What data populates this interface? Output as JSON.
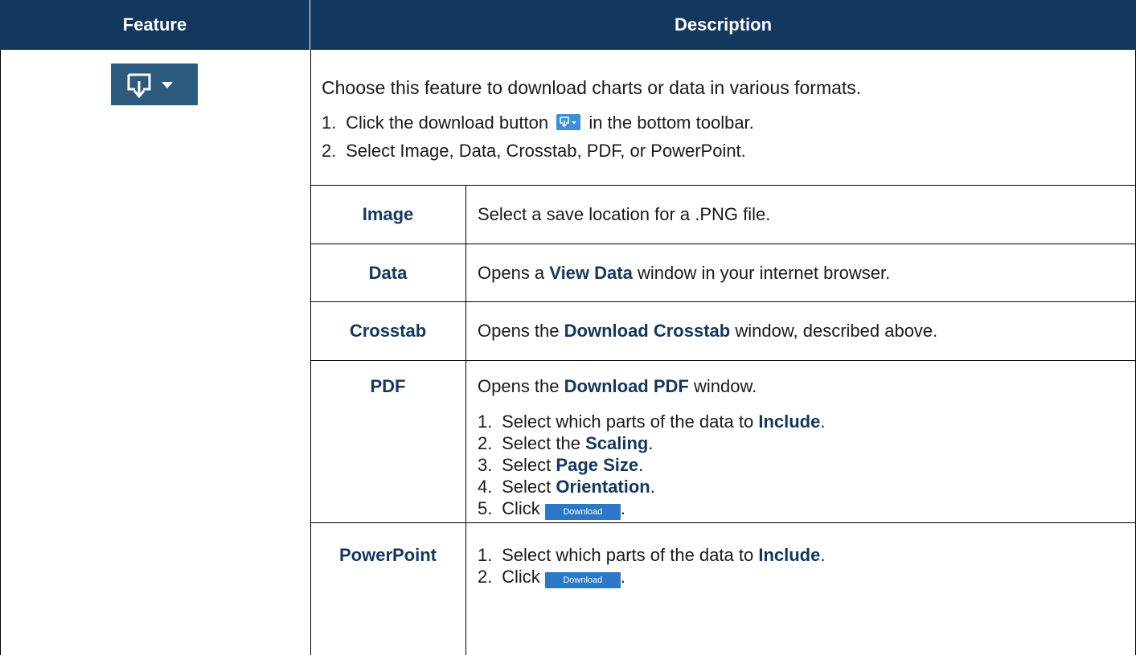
{
  "header": {
    "feature": "Feature",
    "description": "Description"
  },
  "intro": "Choose this feature to download charts or data in various formats.",
  "steps": {
    "s1_num": "1.",
    "s1_pre": "Click the download button",
    "s1_post": "in the bottom toolbar.",
    "s2_num": "2.",
    "s2_text": "Select Image, Data, Crosstab, PDF, or PowerPoint."
  },
  "rows": {
    "image": {
      "label": "Image",
      "text": "Select a save location for a .PNG file."
    },
    "data": {
      "label": "Data",
      "pre": "Opens a",
      "bold": "View Data",
      "post": "window in your internet browser."
    },
    "crosstab": {
      "label": "Crosstab",
      "pre": "Opens the",
      "bold": "Download Crosstab",
      "post": "window, described above."
    },
    "pdf": {
      "label": "PDF",
      "intro_pre": "Opens the",
      "intro_bold": "Download PDF",
      "intro_post": "window.",
      "s1_num": "1.",
      "s1_pre": "Select which parts of the data to",
      "s1_bold": "Include",
      "s1_post": ".",
      "s2_num": "2.",
      "s2_pre": "Select the",
      "s2_bold": "Scaling",
      "s2_post": ".",
      "s3_num": "3.",
      "s3_pre": "Select",
      "s3_bold": "Page Size",
      "s3_post": ".",
      "s4_num": "4.",
      "s4_pre": "Select",
      "s4_bold": "Orientation",
      "s4_post": ".",
      "s5_num": "5.",
      "s5_pre": "Click",
      "s5_post": "."
    },
    "powerpoint": {
      "label": "PowerPoint",
      "s1_num": "1.",
      "s1_pre": "Select which parts of the data to",
      "s1_bold": "Include",
      "s1_post": ".",
      "s2_num": "2.",
      "s2_pre": "Click",
      "s2_post": "."
    }
  },
  "download_button_label": "Download",
  "icons": {
    "feature": "download-icon",
    "inline": "download-icon"
  },
  "colors": {
    "header_bg": "#14375e",
    "accent_text": "#14375e",
    "icon_bg": "#2c5a7f",
    "button_bg": "#2a78c6"
  }
}
